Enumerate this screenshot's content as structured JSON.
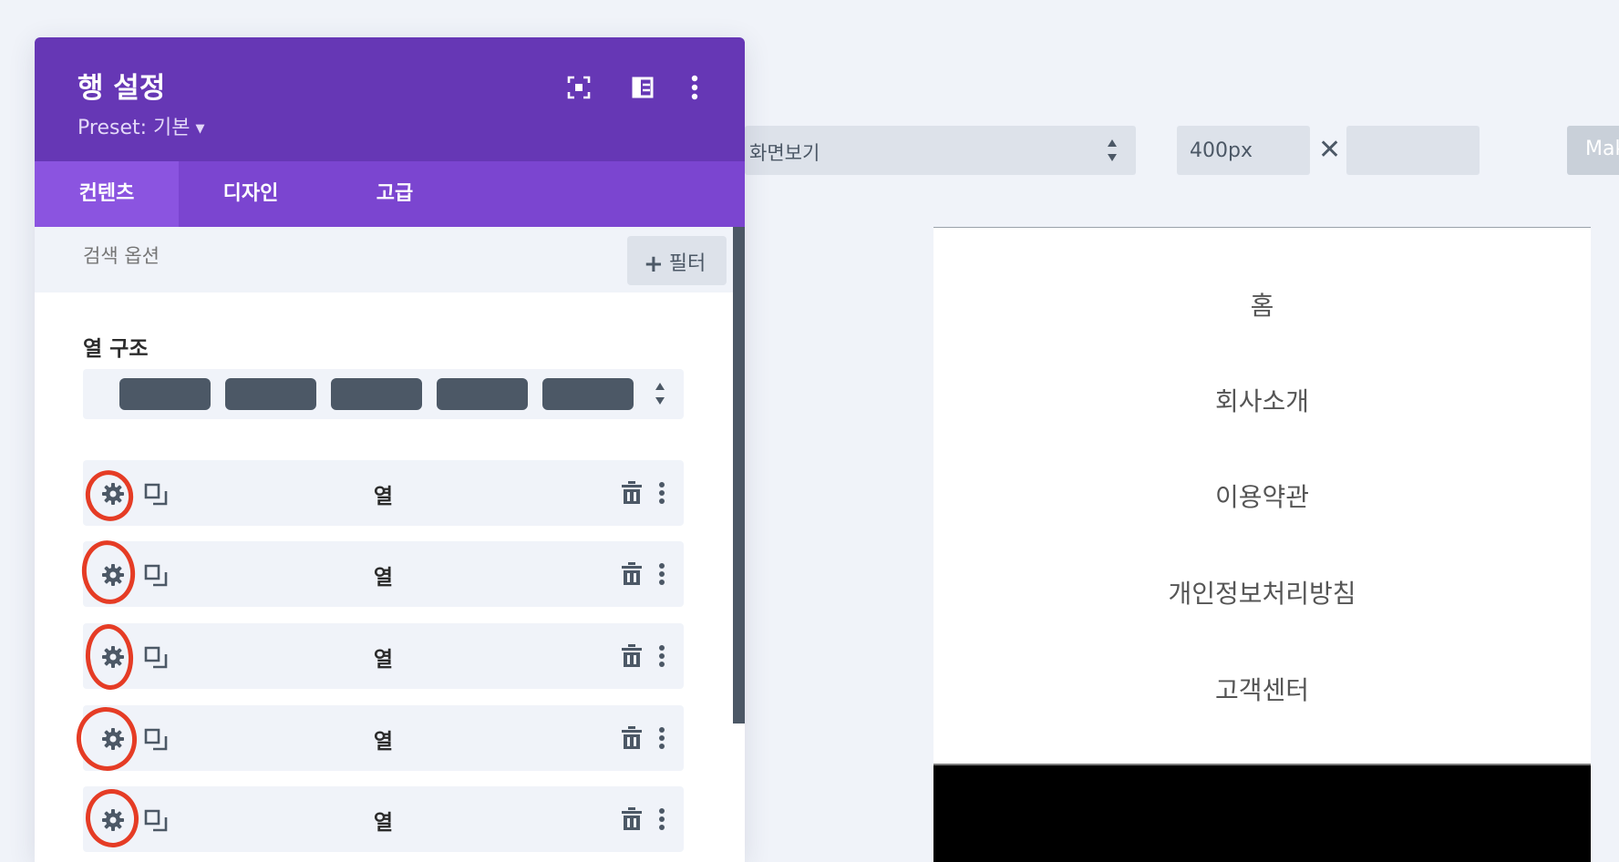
{
  "toolbar": {
    "view_mode": "화면보기",
    "width_value": "400px",
    "times_symbol": "✕",
    "height_value": "",
    "make_button": "Make"
  },
  "preview": {
    "nav_items": [
      "홈",
      "회사소개",
      "이용약관",
      "개인정보처리방침",
      "고객센터"
    ]
  },
  "modal": {
    "title": "행 설정",
    "preset_label": "Preset: 기본",
    "header_icons": [
      "expand-icon",
      "split-view-icon",
      "more-vertical-icon"
    ],
    "tabs": [
      {
        "label": "컨텐츠",
        "active": true
      },
      {
        "label": "디자인",
        "active": false
      },
      {
        "label": "고급",
        "active": false
      }
    ],
    "search_placeholder": "검색 옵션",
    "filter_button": "필터",
    "column_structure_label": "열 구조",
    "column_structure_blocks": 5,
    "columns": [
      {
        "label": "열"
      },
      {
        "label": "열"
      },
      {
        "label": "열"
      },
      {
        "label": "열"
      },
      {
        "label": "열"
      }
    ]
  },
  "colors": {
    "header_purple": "#6637b5",
    "tab_purple": "#7b45d0",
    "tab_active": "#8b54e0",
    "annotation_red": "#e53c25",
    "control_gray": "#4c5866"
  }
}
